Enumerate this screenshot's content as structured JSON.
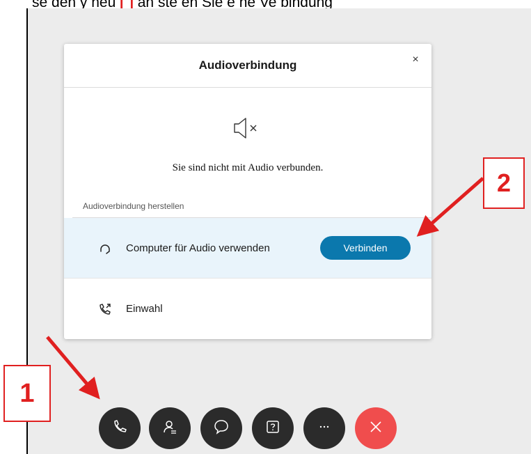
{
  "instruction": {
    "prefix": "se den y neu ",
    "highlight": "[ ]",
    "suffix": " an ste en Sie e ne Ve bindung"
  },
  "dialog": {
    "title": "Audioverbindung",
    "close_label": "×",
    "status_icon": "speaker-muted-icon",
    "status_text": "Sie sind nicht mit Audio verbunden.",
    "section_label": "Audioverbindung herstellen",
    "options": [
      {
        "icon": "headset-icon",
        "label": "Computer für Audio verwenden",
        "button_label": "Verbinden",
        "highlighted": true
      },
      {
        "icon": "phone-dial-icon",
        "label": "Einwahl"
      }
    ]
  },
  "callouts": {
    "one": "1",
    "two": "2"
  },
  "toolbar": {
    "buttons": [
      {
        "icon": "phone-icon"
      },
      {
        "icon": "participants-icon"
      },
      {
        "icon": "chat-icon"
      },
      {
        "icon": "help-icon"
      },
      {
        "icon": "more-icon"
      },
      {
        "icon": "leave-icon"
      }
    ]
  },
  "colors": {
    "accent": "#0b78ad",
    "annotation": "#e02020",
    "leave": "#f04d4d",
    "toolbar": "#2b2b2b",
    "highlight_row": "#e9f4fb"
  }
}
